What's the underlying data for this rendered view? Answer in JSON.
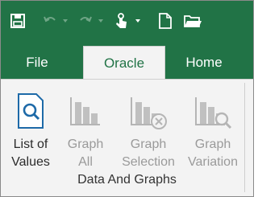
{
  "tabs": [
    {
      "label": "File"
    },
    {
      "label": "Oracle"
    },
    {
      "label": "Home"
    }
  ],
  "ribbon": {
    "group_label": "Data And Graphs",
    "buttons": [
      {
        "line1": "List of",
        "line2": "Values",
        "icon": "search-icon",
        "enabled": true
      },
      {
        "line1": "Graph",
        "line2": "All",
        "icon": "bar-chart-icon",
        "enabled": false
      },
      {
        "line1": "Graph",
        "line2": "Selection",
        "icon": "bar-chart-selection-icon",
        "enabled": false
      },
      {
        "line1": "Graph",
        "line2": "Variation",
        "icon": "bar-chart-variation-icon",
        "enabled": false
      }
    ]
  },
  "colors": {
    "accent": "#217346",
    "ribbon_bg": "#f3f3f3",
    "disabled": "#9a9a9a"
  }
}
